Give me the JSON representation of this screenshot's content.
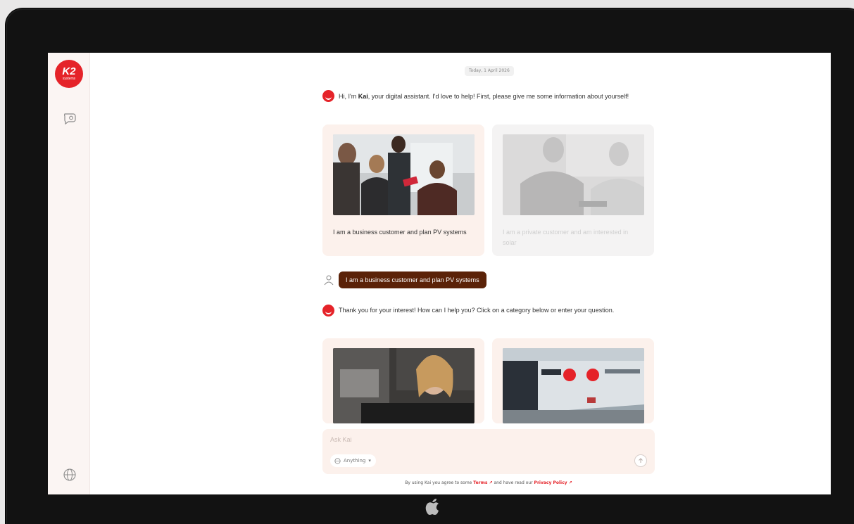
{
  "brand": {
    "logo_text": "K2",
    "logo_subtext": "systems",
    "accent": "#e52329",
    "bubble_color": "#5b2208"
  },
  "sidebar": {
    "icons": [
      "chat-icon",
      "globe-icon"
    ]
  },
  "chat": {
    "date": "Today, 1 April 2026",
    "greeting_pre": "Hi, I'm ",
    "greeting_name": "Kai",
    "greeting_post": ", your digital assistant. I'd love to help! First, please give me some information about yourself!",
    "option_cards": [
      {
        "label": "I am a business customer and plan PV systems",
        "state": "selected"
      },
      {
        "label": "I am a private customer and am interested in solar",
        "state": "inactive"
      }
    ],
    "user_reply": "I am a business customer and plan PV systems",
    "followup": "Thank you for your interest! How can I help you? Click on a category below or enter your question.",
    "category_cards": [
      {
        "label": "",
        "image": "woman-at-computer"
      },
      {
        "label": "",
        "image": "k2-building"
      }
    ]
  },
  "input": {
    "placeholder": "Ask Kai",
    "scope_label": "Anything",
    "scope_chevron": "▾"
  },
  "footer": {
    "pre": "By using Kai you agree to some ",
    "terms": "Terms ↗",
    "mid": " and have read our ",
    "privacy": "Privacy Policy ↗"
  }
}
